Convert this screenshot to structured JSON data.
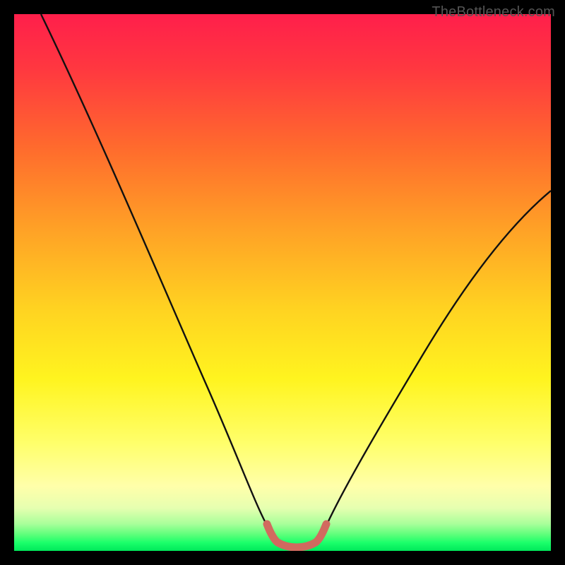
{
  "attribution": "TheBottleneck.com",
  "chart_data": {
    "type": "line",
    "title": "",
    "xlabel": "",
    "ylabel": "",
    "xlim": [
      0,
      100
    ],
    "ylim": [
      0,
      100
    ],
    "x": [
      0,
      5,
      10,
      15,
      20,
      25,
      30,
      35,
      40,
      45,
      47,
      50,
      53,
      55,
      57,
      60,
      65,
      70,
      75,
      80,
      85,
      90,
      95,
      100
    ],
    "series": [
      {
        "name": "bottleneck-curve",
        "values": [
          100,
          90,
          80,
          70,
          60,
          50,
          40,
          30,
          20,
          8,
          3,
          0.5,
          0.5,
          0.5,
          3,
          8,
          15,
          23,
          31,
          39,
          46,
          53,
          59,
          64
        ]
      }
    ],
    "highlight": {
      "name": "optimal-range",
      "x_range": [
        47,
        57
      ],
      "value": 0.5,
      "color": "#d16a5f"
    },
    "colors": {
      "curve": "#111111",
      "highlight": "#d16a5f",
      "gradient_top": "#ff1f4b",
      "gradient_mid": "#ffd321",
      "gradient_bottom": "#00e85a",
      "frame": "#000000"
    }
  }
}
